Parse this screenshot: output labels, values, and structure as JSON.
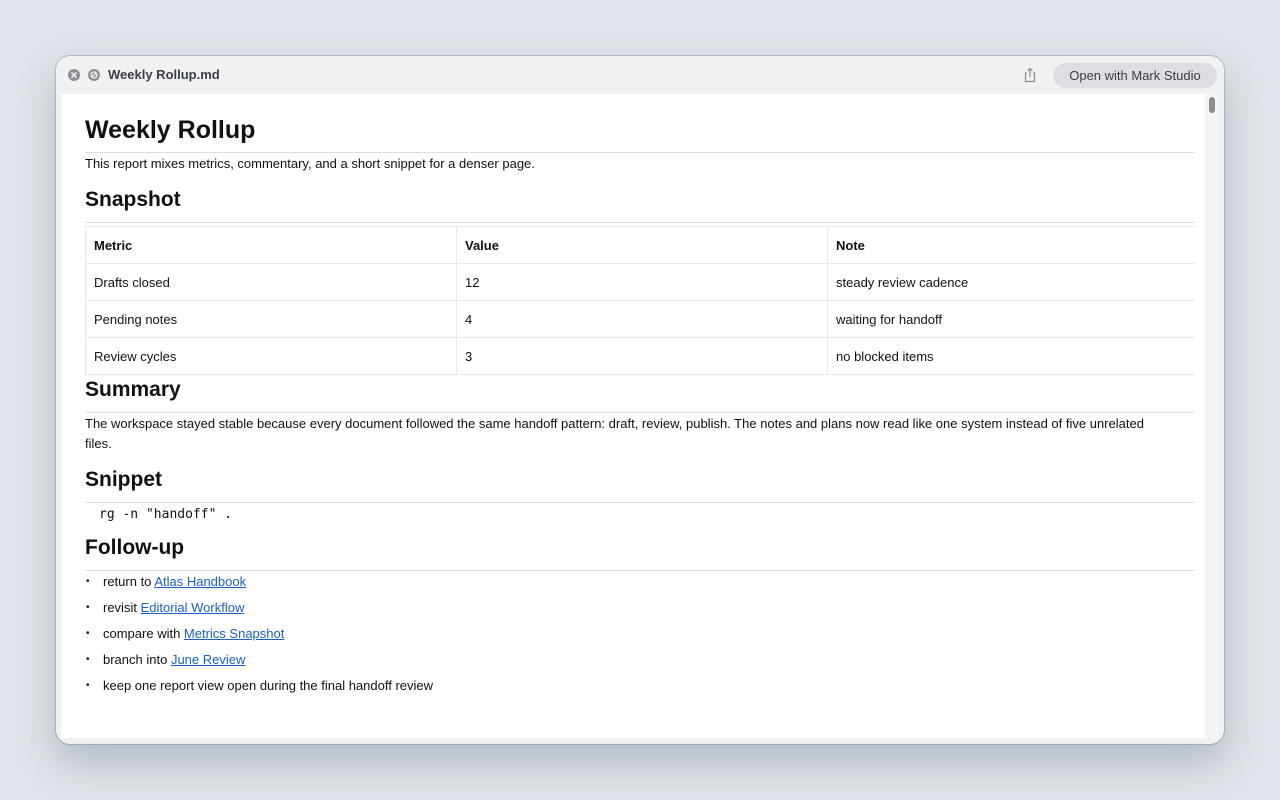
{
  "window": {
    "title": "Weekly Rollup.md",
    "open_button": "Open with Mark Studio"
  },
  "doc": {
    "title": "Weekly Rollup",
    "intro": "This report mixes metrics, commentary, and a short snippet for a denser page.",
    "snapshot": {
      "heading": "Snapshot",
      "columns": [
        "Metric",
        "Value",
        "Note"
      ],
      "rows": [
        [
          "Drafts closed",
          "12",
          "steady review cadence"
        ],
        [
          "Pending notes",
          "4",
          "waiting for handoff"
        ],
        [
          "Review cycles",
          "3",
          "no blocked items"
        ]
      ]
    },
    "summary": {
      "heading": "Summary",
      "text": "The workspace stayed stable because every document followed the same handoff pattern: draft, review, publish. The notes and plans now read like one system instead of five unrelated files."
    },
    "snippet": {
      "heading": "Snippet",
      "code": "rg -n \"handoff\" ."
    },
    "followup": {
      "heading": "Follow-up",
      "bullet": "•",
      "items": [
        {
          "prefix": "return to ",
          "link": "Atlas Handbook"
        },
        {
          "prefix": "revisit ",
          "link": "Editorial Workflow"
        },
        {
          "prefix": "compare with ",
          "link": "Metrics Snapshot"
        },
        {
          "prefix": "branch into ",
          "link": "June Review"
        },
        {
          "prefix": "keep one report view open during the final handoff review",
          "link": null
        }
      ]
    }
  },
  "colors": {
    "link": "#1a5fc4",
    "background": "#dfe5ea",
    "window": "#eff1f3"
  },
  "icons": [
    "close-icon",
    "block-icon",
    "share-icon"
  ]
}
